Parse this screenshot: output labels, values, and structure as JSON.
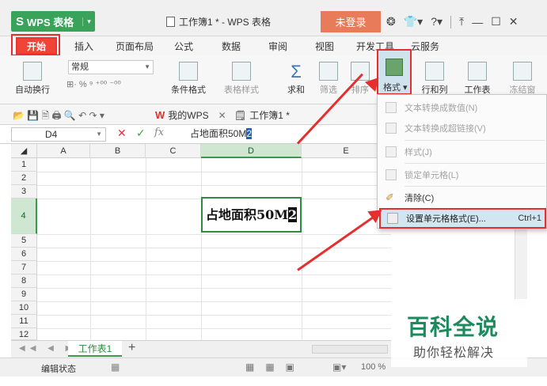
{
  "app": {
    "app_name": "WPS 表格",
    "window_title": "工作簿1 * - WPS 表格",
    "login_label": "未登录"
  },
  "menu_tabs": [
    "开始",
    "插入",
    "页面布局",
    "公式",
    "数据",
    "审阅",
    "视图",
    "开发工具",
    "云服务"
  ],
  "ribbon": {
    "wrap_text": "自动换行",
    "number_format": "常规",
    "cond_format": "条件格式",
    "table_style": "表格样式",
    "sum": "求和",
    "filter": "筛选",
    "sort": "排序",
    "format": "格式",
    "row_col": "行和列",
    "worksheet": "工作表",
    "freeze": "冻结窗"
  },
  "quickbar": {
    "my_wps": "我的WPS",
    "workbook_tab": "工作簿1 *"
  },
  "formula_bar": {
    "name_box": "D4",
    "fx": "fx",
    "content_prefix": "占地面积50M",
    "content_selected": "2"
  },
  "columns": [
    "A",
    "B",
    "C",
    "D",
    "E"
  ],
  "rows": [
    "1",
    "2",
    "3",
    "4",
    "5",
    "6",
    "7",
    "8",
    "9",
    "10",
    "11",
    "12"
  ],
  "cell_d4": {
    "prefix": "占地面积50M",
    "cursor_char": "2"
  },
  "format_menu": [
    {
      "label": "文本转换成数值(N)",
      "enabled": false,
      "shortcut": ""
    },
    {
      "label": "文本转换成超链接(V)",
      "enabled": false,
      "shortcut": ""
    },
    {
      "label": "样式(J)",
      "enabled": false,
      "shortcut": ""
    },
    {
      "label": "锁定单元格(L)",
      "enabled": false,
      "shortcut": ""
    },
    {
      "label": "清除(C)",
      "enabled": true,
      "shortcut": ""
    },
    {
      "label": "设置单元格格式(E)...",
      "enabled": true,
      "shortcut": "Ctrl+1"
    }
  ],
  "sheets": [
    "工作表1"
  ],
  "status": {
    "mode": "编辑状态",
    "zoom": "100 %"
  },
  "watermark": {
    "title": "百科全说",
    "subtitle": "助你轻松解决"
  },
  "colors": {
    "accent_green": "#3aa35a",
    "active_tab_red": "#ef4437",
    "highlight_red": "#e52e2e",
    "login_orange": "#e87b5a"
  }
}
